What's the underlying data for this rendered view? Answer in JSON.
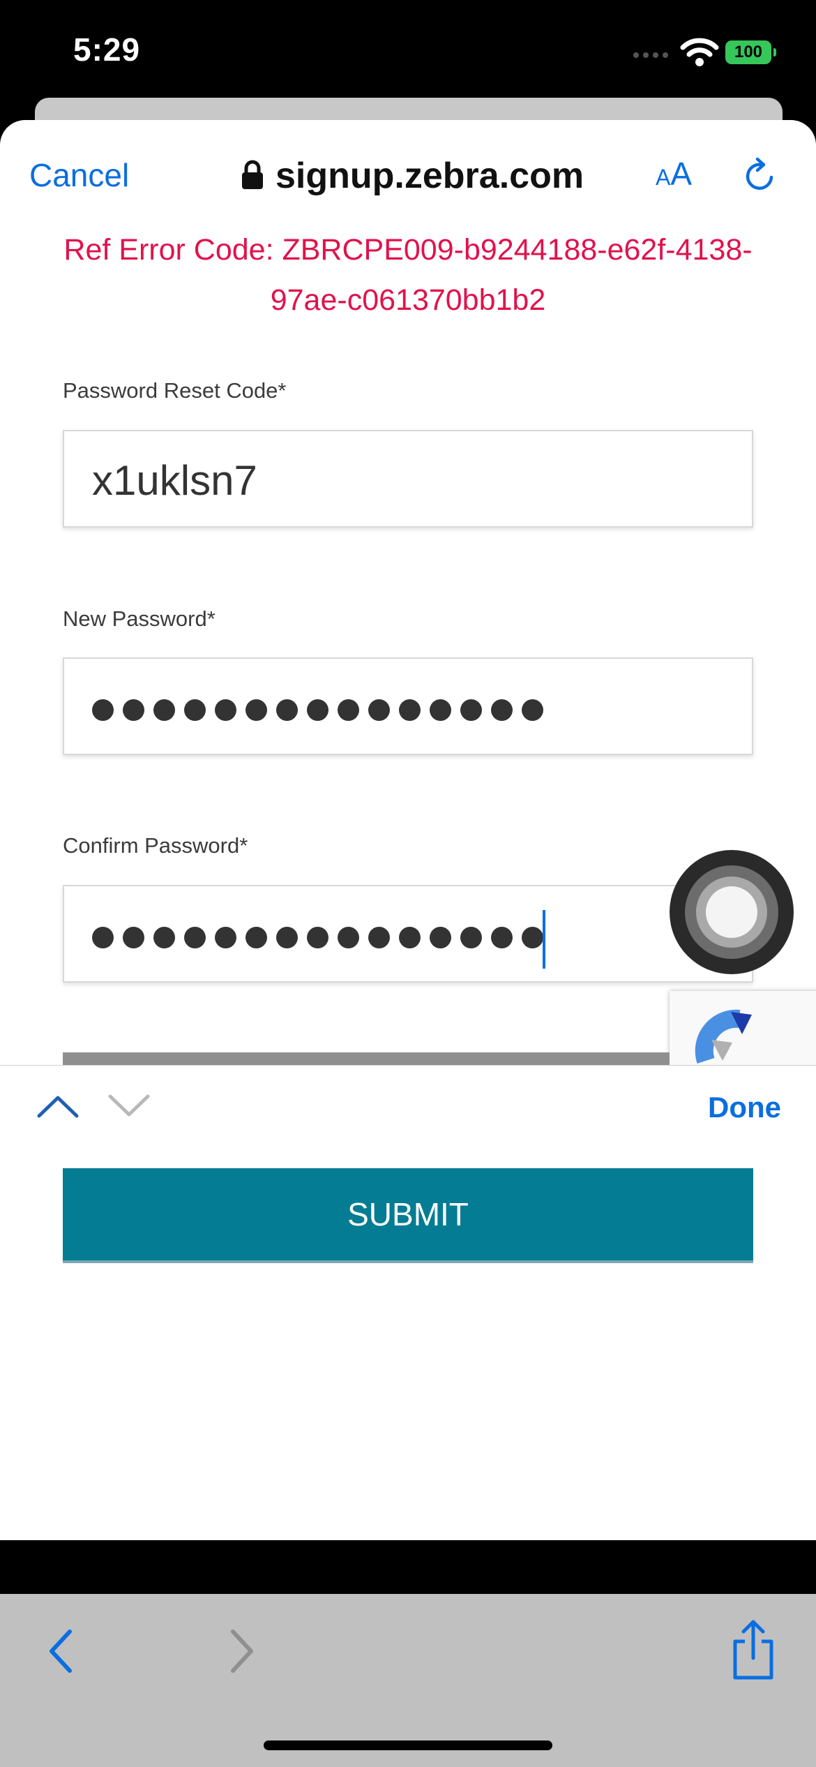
{
  "status_bar": {
    "time": "5:29",
    "battery": "100",
    "icons": [
      "signal-dots-icon",
      "wifi-icon",
      "battery-icon"
    ]
  },
  "browser_nav": {
    "cancel_label": "Cancel",
    "url": "signup.zebra.com",
    "text_size_small": "A",
    "text_size_large": "A",
    "icons": [
      "lock-icon",
      "reload-icon"
    ]
  },
  "error": {
    "line1": "Ref Error Code: ZBRCPE009-b9244188-e62f-4138-",
    "line2": "97ae-c061370bb1b2",
    "color": "#e0124c"
  },
  "form": {
    "reset_code": {
      "label": "Password Reset Code*",
      "value": "x1uklsn7"
    },
    "new_password": {
      "label": "New Password*",
      "masked_length": 15
    },
    "confirm_password": {
      "label": "Confirm Password*",
      "masked_length": 15
    }
  },
  "keyboard_accessory": {
    "done_label": "Done",
    "icons": [
      "chevron-up-icon",
      "chevron-down-icon"
    ]
  },
  "submit": {
    "label": "SUBMIT",
    "color": "#047c93"
  },
  "toolbar": {
    "icons": [
      "back-icon",
      "forward-icon",
      "share-icon"
    ]
  },
  "colors": {
    "accent": "#0a6ee0",
    "battery": "#35c759"
  }
}
